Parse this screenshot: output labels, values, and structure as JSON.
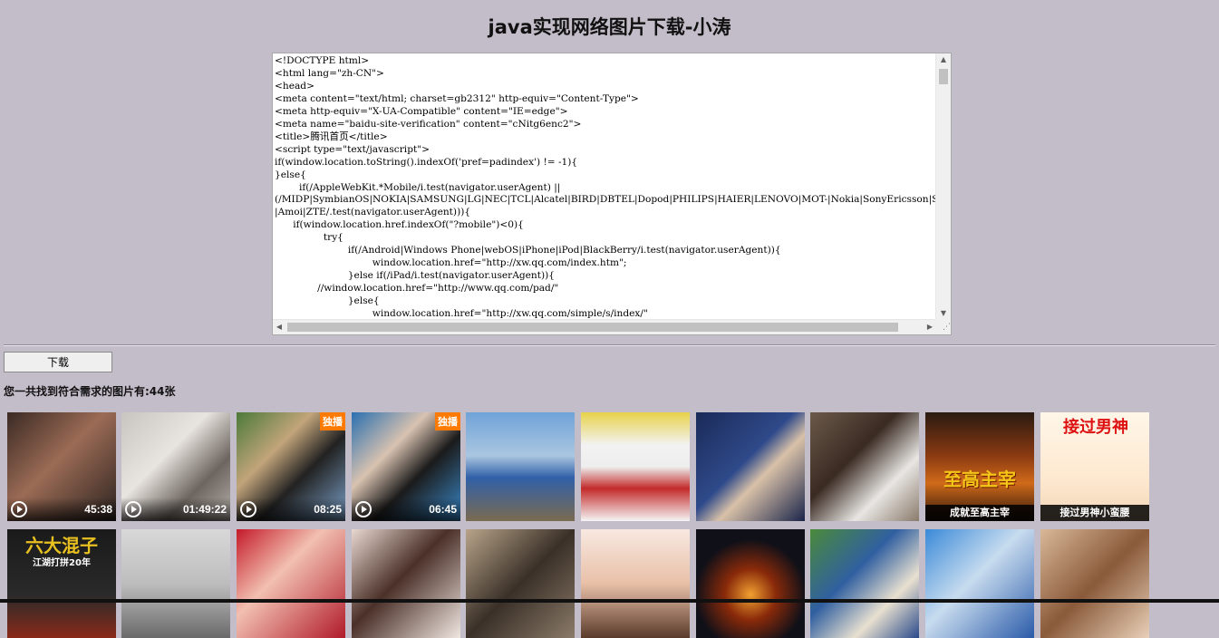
{
  "page": {
    "title": "java实现网络图片下载-小涛",
    "download_label": "下载",
    "found_text": "您一共找到符合需求的图片有:44张"
  },
  "source_code": {
    "text": "<!DOCTYPE html>\n<html lang=\"zh-CN\">\n<head>\n<meta content=\"text/html; charset=gb2312\" http-equiv=\"Content-Type\">\n<meta http-equiv=\"X-UA-Compatible\" content=\"IE=edge\">\n<meta name=\"baidu-site-verification\" content=\"cNitg6enc2\">\n<title>腾讯首页</title>\n<script type=\"text/javascript\">\nif(window.location.toString().indexOf('pref=padindex') != -1){\n}else{\n        if(/AppleWebKit.*Mobile/i.test(navigator.userAgent) ||\n(/MIDP|SymbianOS|NOKIA|SAMSUNG|LG|NEC|TCL|Alcatel|BIRD|DBTEL|Dopod|PHILIPS|HAIER|LENOVO|MOT-|Nokia|SonyEricsson|SIE-\n|Amoi|ZTE/.test(navigator.userAgent))){\n      if(window.location.href.indexOf(\"?mobile\")<0){\n                try{\n                        if(/Android|Windows Phone|webOS|iPhone|iPod|BlackBerry/i.test(navigator.userAgent)){\n                                window.location.href=\"http://xw.qq.com/index.htm\";\n                        }else if(/iPad/i.test(navigator.userAgent)){\n              //window.location.href=\"http://www.qq.com/pad/\"\n                        }else{\n                                window.location.href=\"http://xw.qq.com/simple/s/index/\""
  },
  "images_row1": [
    {
      "duration": "45:38"
    },
    {
      "duration": "01:49:22"
    },
    {
      "duration": "08:25",
      "badge": "独播"
    },
    {
      "duration": "06:45",
      "badge": "独播"
    },
    {},
    {},
    {},
    {},
    {
      "caption": "成就至高主宰",
      "art_title": "至高主宰"
    },
    {
      "caption": "接过男神小蛮腰",
      "comic_title": "接过男神"
    }
  ],
  "images_row2": [
    {
      "poster_title": "六大混子",
      "poster_sub": "江湖打拼20年"
    },
    {},
    {},
    {},
    {},
    {},
    {},
    {},
    {},
    {}
  ]
}
